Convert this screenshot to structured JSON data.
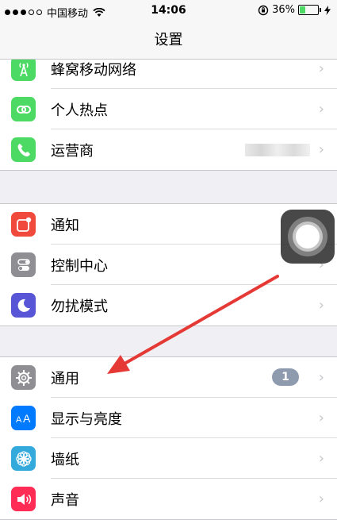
{
  "status_bar": {
    "carrier": "中国移动",
    "time": "14:06",
    "battery_percent": "36%",
    "battery_level": 0.36,
    "signal_dots_filled": 3,
    "signal_dots_total": 5
  },
  "nav": {
    "title": "设置"
  },
  "groups": [
    {
      "items": [
        {
          "label": "蜂窝移动网络",
          "icon": "cellular-antenna-icon",
          "color": "#4cd964"
        },
        {
          "label": "个人热点",
          "icon": "hotspot-link-icon",
          "color": "#4cd964"
        },
        {
          "label": "运营商",
          "icon": "phone-icon",
          "color": "#4cd964"
        }
      ]
    },
    {
      "items": [
        {
          "label": "通知",
          "icon": "notifications-icon",
          "color": "#f04a3c"
        },
        {
          "label": "控制中心",
          "icon": "control-center-icon",
          "color": "#8e8e93"
        },
        {
          "label": "勿扰模式",
          "icon": "moon-icon",
          "color": "#5856d6"
        }
      ]
    },
    {
      "items": [
        {
          "label": "通用",
          "icon": "gear-icon",
          "color": "#8e8e93",
          "badge": "1"
        },
        {
          "label": "显示与亮度",
          "icon": "display-aa-icon",
          "color": "#007aff"
        },
        {
          "label": "墙纸",
          "icon": "wallpaper-flower-icon",
          "color": "#34aadc"
        },
        {
          "label": "声音",
          "icon": "speaker-icon",
          "color": "#ff2d55"
        }
      ]
    }
  ],
  "chevron": "›",
  "annotation_arrow_color": "#e53935"
}
